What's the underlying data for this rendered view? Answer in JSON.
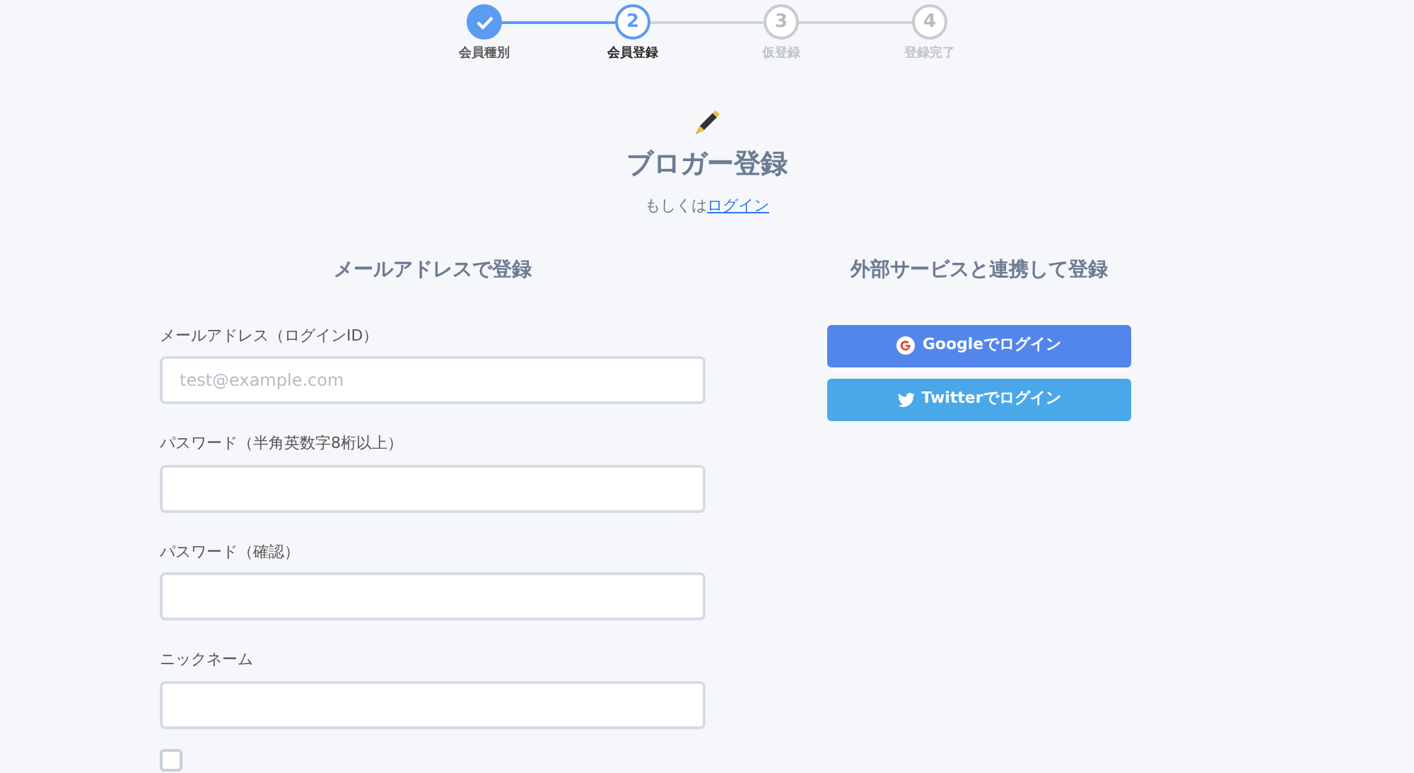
{
  "steps": [
    {
      "label": "会員種別",
      "completed": true,
      "selected": false
    },
    {
      "number": "2",
      "label": "会員登録",
      "completed": false,
      "selected": true
    },
    {
      "number": "3",
      "label": "仮登録",
      "completed": false,
      "selected": false
    },
    {
      "number": "4",
      "label": "登録完了",
      "completed": false,
      "selected": false
    }
  ],
  "title": "ブロガー登録",
  "subtitle": {
    "text": "もしくは",
    "link": "ログイン"
  },
  "email_section": {
    "heading": "メールアドレスで登録",
    "fields": [
      {
        "label": "メールアドレス（ログインID）",
        "placeholder": "test@example.com"
      },
      {
        "label": "パスワード（半角英数字8桁以上）"
      },
      {
        "label": "パスワード（確認）"
      },
      {
        "label": "ニックネーム"
      }
    ],
    "agree_checkbox": {
      "checked": false
    }
  },
  "social_section": {
    "heading": "外部サービスと連携して登録",
    "buttons": [
      {
        "kind": "google",
        "label": "Googleでログイン"
      },
      {
        "kind": "twitter",
        "label": "Twitterでログイン"
      }
    ]
  }
}
